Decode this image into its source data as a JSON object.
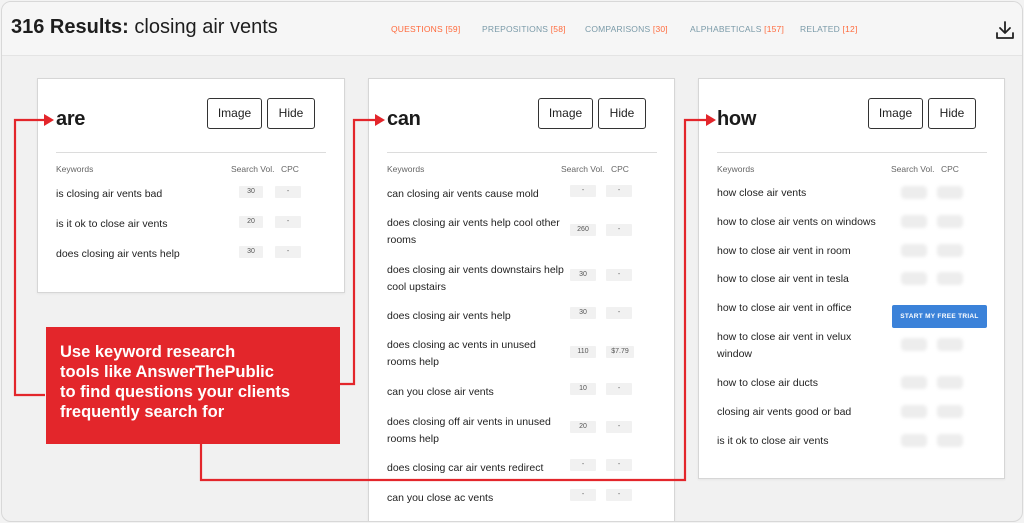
{
  "header": {
    "results_count": "316 Results:",
    "query": "closing air vents",
    "tabs": [
      {
        "label": "QUESTIONS",
        "count": "[59]"
      },
      {
        "label": "PREPOSITIONS",
        "count": "[58]"
      },
      {
        "label": "COMPARISONS",
        "count": "[30]"
      },
      {
        "label": "ALPHABETICALS",
        "count": "[157]"
      },
      {
        "label": "RELATED",
        "count": "[12]"
      }
    ],
    "download_icon": "download-icon"
  },
  "columns": {
    "keywords": "Keywords",
    "search_vol": "Search Vol.",
    "cpc": "CPC"
  },
  "buttons": {
    "image": "Image",
    "hide": "Hide"
  },
  "cards": [
    {
      "title": "are",
      "rows": [
        {
          "keyword": "is closing air vents bad",
          "vol": "30",
          "cpc": "-"
        },
        {
          "keyword": "is it ok to close air vents",
          "vol": "20",
          "cpc": "-"
        },
        {
          "keyword": "does closing air vents help",
          "vol": "30",
          "cpc": "-"
        }
      ]
    },
    {
      "title": "can",
      "rows": [
        {
          "keyword": "can closing air vents cause mold",
          "vol": "-",
          "cpc": "-"
        },
        {
          "keyword": "does closing air vents help cool other rooms",
          "vol": "260",
          "cpc": "-"
        },
        {
          "keyword": "does closing air vents downstairs help cool upstairs",
          "vol": "30",
          "cpc": "-"
        },
        {
          "keyword": "does closing air vents help",
          "vol": "30",
          "cpc": "-"
        },
        {
          "keyword": "does closing ac vents in unused rooms help",
          "vol": "110",
          "cpc": "$7.79"
        },
        {
          "keyword": "can you close air vents",
          "vol": "10",
          "cpc": "-"
        },
        {
          "keyword": "does closing off air vents in unused rooms help",
          "vol": "20",
          "cpc": "-"
        },
        {
          "keyword": "does closing car air vents redirect",
          "vol": "-",
          "cpc": "-"
        },
        {
          "keyword": "can you close ac vents",
          "vol": "-",
          "cpc": "-"
        }
      ]
    },
    {
      "title": "how",
      "rows": [
        {
          "keyword": "how close air vents"
        },
        {
          "keyword": "how to close air vents on windows"
        },
        {
          "keyword": "how to close air vent in room"
        },
        {
          "keyword": "how to close air vent in tesla"
        },
        {
          "keyword": "how to close air vent in office"
        },
        {
          "keyword": "how to close air vent in velux window"
        },
        {
          "keyword": "how to close air ducts"
        },
        {
          "keyword": "closing air vents good or bad"
        },
        {
          "keyword": "is it ok to close air vents"
        }
      ],
      "cta": "START MY FREE TRIAL"
    }
  ],
  "callout": "Use keyword research\ntools like AnswerThePublic\nto find questions your clients\nfrequently search for",
  "colors": {
    "accent": "#ff6a3c",
    "callout": "#e3262b",
    "cta": "#3b82d9",
    "tab_text": "#7a9aa8"
  }
}
